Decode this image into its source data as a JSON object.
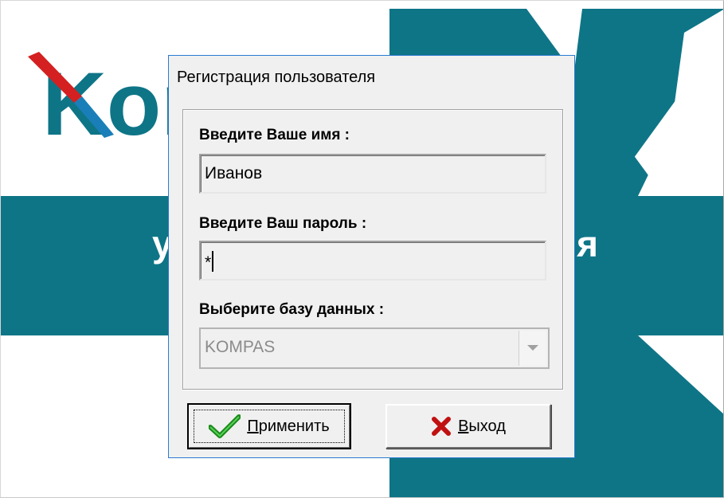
{
  "background": {
    "brand_color": "#0e7587",
    "logo_text": "Kom",
    "banner_left_glyph": "у",
    "banner_right_glyph": "я"
  },
  "dialog": {
    "title": "Регистрация пользователя",
    "name_label": "Введите Ваше имя :",
    "name_value": "Иванов",
    "password_label": "Введите Ваш пароль :",
    "password_value": "*",
    "database_label": "Выберите базу данных :",
    "database_value": "KOMPAS",
    "apply_first_letter": "П",
    "apply_rest": "рименить",
    "exit_first_letter": "В",
    "exit_rest": "ыход",
    "apply_icon": "checkmark-icon",
    "exit_icon": "cross-icon"
  }
}
